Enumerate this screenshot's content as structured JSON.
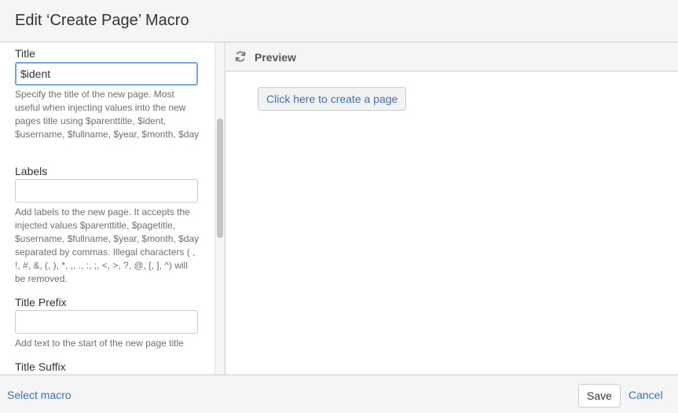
{
  "dialog": {
    "title": "Edit ‘Create Page’ Macro"
  },
  "form": {
    "title_field": {
      "label": "Title",
      "value": "$ident",
      "description": "Specify the title of the new page. Most useful when injecting values into the new pages title using $parenttitle, $ident, $username, $fullname, $year, $month, $day"
    },
    "labels_field": {
      "label": "Labels",
      "value": "",
      "description": "Add labels to the new page. It accepts the injected values $parenttitle, $pagetitle, $username, $fullname, $year, $month, $day separated by commas. Illegal characters ( , !, #, &, (, ), *, ,, ., :, ;, <, >, ?, @, [, ], ^) will be removed."
    },
    "title_prefix_field": {
      "label": "Title Prefix",
      "value": "",
      "description": "Add text to the start of the new page title"
    },
    "title_suffix_field": {
      "label": "Title Suffix"
    }
  },
  "preview": {
    "label": "Preview",
    "refresh_icon": "refresh-icon",
    "button_label": "Click here to create a page"
  },
  "footer": {
    "select_macro": "Select macro",
    "save": "Save",
    "cancel": "Cancel"
  },
  "colors": {
    "link": "#3b73af",
    "focus_border": "#79a6df",
    "panel_bg": "#f5f5f5",
    "border": "#cccccc"
  }
}
